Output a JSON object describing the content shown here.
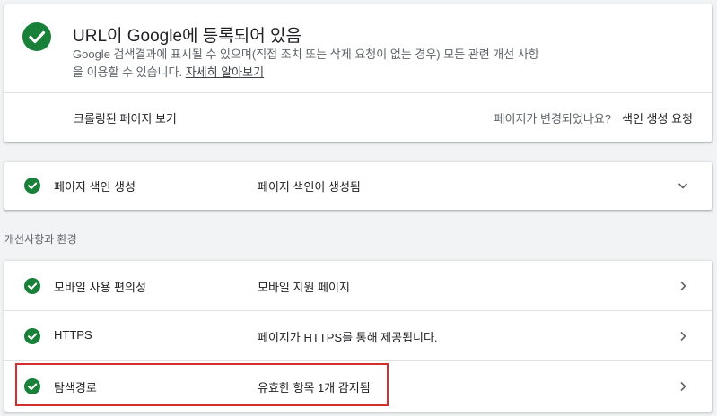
{
  "status": {
    "title": "URL이 Google에 등록되어 있음",
    "description": "Google 검색결과에 표시될 수 있으며(직접 조치 또는 삭제 요청이 없는 경우) 모든 관련 개선 사항을 이용할 수 있습니다.",
    "learn_more": "자세히 알아보기",
    "view_crawled": "크롤링된 페이지 보기",
    "page_changed": "페이지가 변경되었나요?",
    "request_indexing": "색인 생성 요청"
  },
  "indexing": {
    "name": "페이지 색인 생성",
    "value": "페이지 색인이 생성됨",
    "icon": "chevron-down-icon"
  },
  "enhancements": {
    "section_title": "개선사항과 환경",
    "items": [
      {
        "name": "모바일 사용 편의성",
        "value": "모바일 지원 페이지",
        "icon": "chevron-right-icon"
      },
      {
        "name": "HTTPS",
        "value": "페이지가 HTTPS를 통해 제공됩니다.",
        "icon": "chevron-right-icon"
      },
      {
        "name": "탐색경로",
        "value": "유효한 항목 1개 감지됨",
        "icon": "chevron-right-icon"
      }
    ]
  },
  "colors": {
    "success": "#188038",
    "highlight": "#d32f2f",
    "background": "#f1f3f4"
  }
}
